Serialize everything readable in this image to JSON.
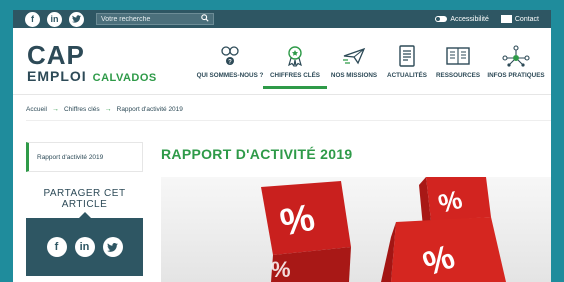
{
  "topbar": {
    "social": [
      {
        "icon": "facebook-icon",
        "glyph": "f"
      },
      {
        "icon": "linkedin-icon",
        "glyph": "in"
      },
      {
        "icon": "twitter-icon",
        "glyph": "t"
      }
    ],
    "search_placeholder": "Votre recherche",
    "accessibility_label": "Accessibilité",
    "contact_label": "Contact"
  },
  "logo": {
    "line1": "CAP",
    "line2": "EMPLOI",
    "region": "CALVADOS"
  },
  "nav": [
    {
      "label": "QUI SOMMES-NOUS ?",
      "icon": "people-icon"
    },
    {
      "label": "CHIFFRES CLÉS",
      "icon": "award-icon",
      "active": true
    },
    {
      "label": "NOS MISSIONS",
      "icon": "paper-plane-icon"
    },
    {
      "label": "ACTUALITÉS",
      "icon": "document-icon"
    },
    {
      "label": "RESSOURCES",
      "icon": "book-icon"
    },
    {
      "label": "INFOS PRATIQUES",
      "icon": "network-icon"
    }
  ],
  "breadcrumb": [
    "Accueil",
    "Chiffres clés",
    "Rapport d'activité 2019"
  ],
  "sidebar": {
    "link": "Rapport d'activité 2019",
    "share_title": "PARTAGER CET ARTICLE"
  },
  "page_title": "RAPPORT D'ACTIVITÉ 2019",
  "colors": {
    "accent": "#2e9a48",
    "dark": "#2d4a57",
    "teal": "#1f8c9c",
    "dice_red": "#d32020"
  }
}
